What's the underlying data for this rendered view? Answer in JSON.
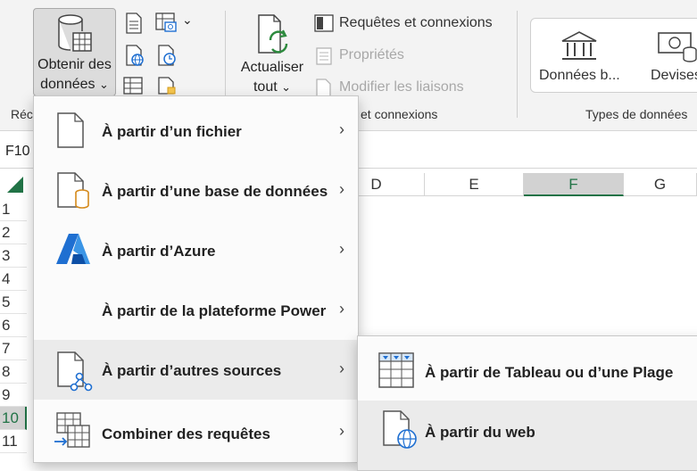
{
  "ribbon": {
    "get_data": {
      "line1": "Obtenir des",
      "line2": "données",
      "caret": "⌄"
    },
    "refresh": {
      "line1": "Actualiser",
      "line2": "tout",
      "caret": "⌄"
    },
    "queries_connections": "Requêtes et connexions",
    "properties": "Propriétés",
    "edit_links": "Modifier les liaisons",
    "group_get_fragment": "Réc",
    "group_queries": "et connexions",
    "group_types": "Types de données",
    "type_stocks": "Données b...",
    "type_currencies": "Devises"
  },
  "sheet": {
    "name_box": "F10",
    "columns": [
      "D",
      "E",
      "F",
      "G"
    ],
    "selected_column": "F",
    "rows": [
      "1",
      "2",
      "3",
      "4",
      "5",
      "6",
      "7",
      "8",
      "9",
      "10",
      "11"
    ],
    "selected_row": "10"
  },
  "menu": {
    "items": [
      {
        "label": "À partir d’un fichier",
        "icon": "file-icon"
      },
      {
        "label": "À partir d’une base de données",
        "icon": "database-file-icon"
      },
      {
        "label": "À partir d’Azure",
        "icon": "azure-icon"
      },
      {
        "label": "À partir de la plateforme Power",
        "icon": ""
      },
      {
        "label": "À partir d’autres sources",
        "icon": "other-sources-icon"
      },
      {
        "label": "Combiner des requêtes",
        "icon": "combine-queries-icon"
      }
    ],
    "chevron": "›"
  },
  "submenu": {
    "items": [
      {
        "label": "À partir de Tableau ou d’une Plage",
        "icon": "table-range-icon"
      },
      {
        "label": "À partir du web",
        "icon": "web-file-icon"
      }
    ]
  }
}
